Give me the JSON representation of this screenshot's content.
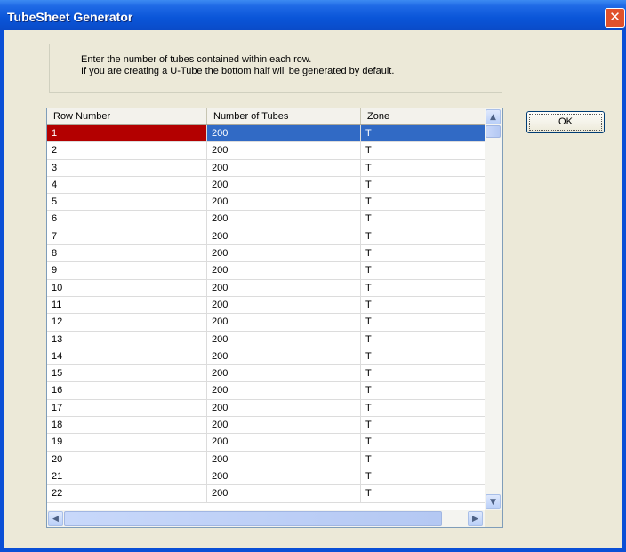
{
  "window": {
    "title": "TubeSheet Generator",
    "close_glyph": "✕"
  },
  "instructions": {
    "line1": "Enter the number of tubes contained within each row.",
    "line2": "If you are creating a U-Tube the bottom half will be generated by default."
  },
  "grid": {
    "columns": [
      "Row Number",
      "Number of Tubes",
      "Zone"
    ],
    "rows": [
      [
        "1",
        "200",
        "T"
      ],
      [
        "2",
        "200",
        "T"
      ],
      [
        "3",
        "200",
        "T"
      ],
      [
        "4",
        "200",
        "T"
      ],
      [
        "5",
        "200",
        "T"
      ],
      [
        "6",
        "200",
        "T"
      ],
      [
        "7",
        "200",
        "T"
      ],
      [
        "8",
        "200",
        "T"
      ],
      [
        "9",
        "200",
        "T"
      ],
      [
        "10",
        "200",
        "T"
      ],
      [
        "11",
        "200",
        "T"
      ],
      [
        "12",
        "200",
        "T"
      ],
      [
        "13",
        "200",
        "T"
      ],
      [
        "14",
        "200",
        "T"
      ],
      [
        "15",
        "200",
        "T"
      ],
      [
        "16",
        "200",
        "T"
      ],
      [
        "17",
        "200",
        "T"
      ],
      [
        "18",
        "200",
        "T"
      ],
      [
        "19",
        "200",
        "T"
      ],
      [
        "20",
        "200",
        "T"
      ],
      [
        "21",
        "200",
        "T"
      ],
      [
        "22",
        "200",
        "T"
      ]
    ],
    "selected_row": 0
  },
  "buttons": {
    "ok_label": "OK"
  },
  "scrollbar_icons": {
    "up": "▲",
    "down": "▼",
    "left": "◀",
    "right": "▶"
  },
  "colors": {
    "selection": "#316ac5",
    "row_header_selected": "#b30000",
    "titlebar": "#0a55d8"
  }
}
